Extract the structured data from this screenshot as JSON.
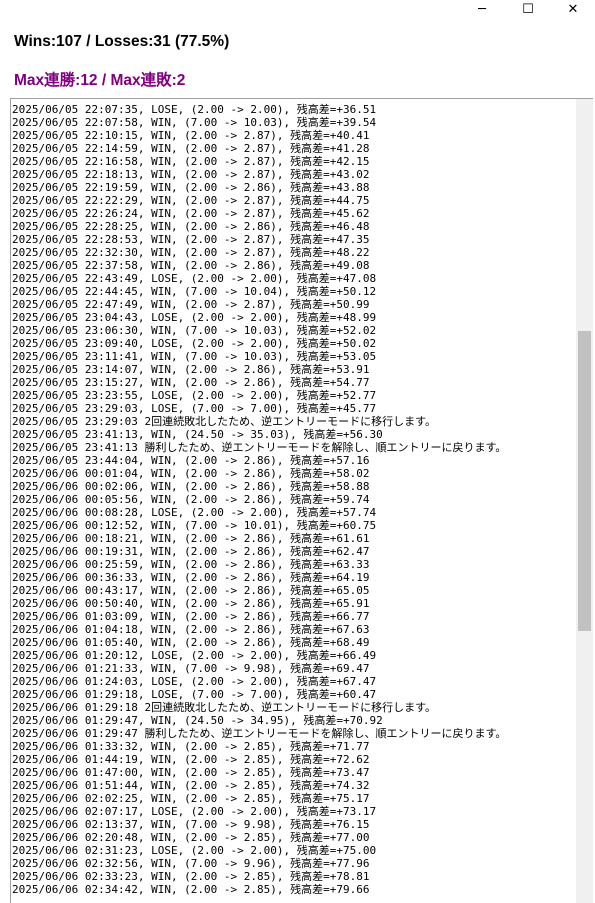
{
  "window": {
    "minimize_glyph": "─",
    "maximize_glyph": "☐",
    "close_glyph": "✕"
  },
  "stats": {
    "text": "Wins:107 / Losses:31 (77.5%)"
  },
  "streak": {
    "text": "Max連勝:12 / Max連敗:2",
    "color": "#800080"
  },
  "scroll": {
    "position_fraction": 0.46
  },
  "log": [
    "2025/06/05 22:07:35, LOSE, (2.00 -> 2.00), 残高差=+36.51",
    "2025/06/05 22:07:58, WIN, (7.00 -> 10.03), 残高差=+39.54",
    "2025/06/05 22:10:15, WIN, (2.00 -> 2.87), 残高差=+40.41",
    "2025/06/05 22:14:59, WIN, (2.00 -> 2.87), 残高差=+41.28",
    "2025/06/05 22:16:58, WIN, (2.00 -> 2.87), 残高差=+42.15",
    "2025/06/05 22:18:13, WIN, (2.00 -> 2.87), 残高差=+43.02",
    "2025/06/05 22:19:59, WIN, (2.00 -> 2.86), 残高差=+43.88",
    "2025/06/05 22:22:29, WIN, (2.00 -> 2.87), 残高差=+44.75",
    "2025/06/05 22:26:24, WIN, (2.00 -> 2.87), 残高差=+45.62",
    "2025/06/05 22:28:25, WIN, (2.00 -> 2.86), 残高差=+46.48",
    "2025/06/05 22:28:53, WIN, (2.00 -> 2.87), 残高差=+47.35",
    "2025/06/05 22:32:30, WIN, (2.00 -> 2.87), 残高差=+48.22",
    "2025/06/05 22:37:58, WIN, (2.00 -> 2.86), 残高差=+49.08",
    "2025/06/05 22:43:49, LOSE, (2.00 -> 2.00), 残高差=+47.08",
    "2025/06/05 22:44:45, WIN, (7.00 -> 10.04), 残高差=+50.12",
    "2025/06/05 22:47:49, WIN, (2.00 -> 2.87), 残高差=+50.99",
    "2025/06/05 23:04:43, LOSE, (2.00 -> 2.00), 残高差=+48.99",
    "2025/06/05 23:06:30, WIN, (7.00 -> 10.03), 残高差=+52.02",
    "2025/06/05 23:09:40, LOSE, (2.00 -> 2.00), 残高差=+50.02",
    "2025/06/05 23:11:41, WIN, (7.00 -> 10.03), 残高差=+53.05",
    "2025/06/05 23:14:07, WIN, (2.00 -> 2.86), 残高差=+53.91",
    "2025/06/05 23:15:27, WIN, (2.00 -> 2.86), 残高差=+54.77",
    "2025/06/05 23:23:55, LOSE, (2.00 -> 2.00), 残高差=+52.77",
    "2025/06/05 23:29:03, LOSE, (7.00 -> 7.00), 残高差=+45.77",
    "2025/06/05 23:29:03 2回連続敗北したため、逆エントリーモードに移行します。",
    "2025/06/05 23:41:13, WIN, (24.50 -> 35.03), 残高差=+56.30",
    "2025/06/05 23:41:13 勝利したため、逆エントリーモードを解除し、順エントリーに戻ります。",
    "2025/06/05 23:44:04, WIN, (2.00 -> 2.86), 残高差=+57.16",
    "2025/06/06 00:01:04, WIN, (2.00 -> 2.86), 残高差=+58.02",
    "2025/06/06 00:02:06, WIN, (2.00 -> 2.86), 残高差=+58.88",
    "2025/06/06 00:05:56, WIN, (2.00 -> 2.86), 残高差=+59.74",
    "2025/06/06 00:08:28, LOSE, (2.00 -> 2.00), 残高差=+57.74",
    "2025/06/06 00:12:52, WIN, (7.00 -> 10.01), 残高差=+60.75",
    "2025/06/06 00:18:21, WIN, (2.00 -> 2.86), 残高差=+61.61",
    "2025/06/06 00:19:31, WIN, (2.00 -> 2.86), 残高差=+62.47",
    "2025/06/06 00:25:59, WIN, (2.00 -> 2.86), 残高差=+63.33",
    "2025/06/06 00:36:33, WIN, (2.00 -> 2.86), 残高差=+64.19",
    "2025/06/06 00:43:17, WIN, (2.00 -> 2.86), 残高差=+65.05",
    "2025/06/06 00:50:40, WIN, (2.00 -> 2.86), 残高差=+65.91",
    "2025/06/06 01:03:09, WIN, (2.00 -> 2.86), 残高差=+66.77",
    "2025/06/06 01:04:18, WIN, (2.00 -> 2.86), 残高差=+67.63",
    "2025/06/06 01:05:40, WIN, (2.00 -> 2.86), 残高差=+68.49",
    "2025/06/06 01:20:12, LOSE, (2.00 -> 2.00), 残高差=+66.49",
    "2025/06/06 01:21:33, WIN, (7.00 -> 9.98), 残高差=+69.47",
    "2025/06/06 01:24:03, LOSE, (2.00 -> 2.00), 残高差=+67.47",
    "2025/06/06 01:29:18, LOSE, (7.00 -> 7.00), 残高差=+60.47",
    "2025/06/06 01:29:18 2回連続敗北したため、逆エントリーモードに移行します。",
    "2025/06/06 01:29:47, WIN, (24.50 -> 34.95), 残高差=+70.92",
    "2025/06/06 01:29:47 勝利したため、逆エントリーモードを解除し、順エントリーに戻ります。",
    "2025/06/06 01:33:32, WIN, (2.00 -> 2.85), 残高差=+71.77",
    "2025/06/06 01:44:19, WIN, (2.00 -> 2.85), 残高差=+72.62",
    "2025/06/06 01:47:00, WIN, (2.00 -> 2.85), 残高差=+73.47",
    "2025/06/06 01:51:44, WIN, (2.00 -> 2.85), 残高差=+74.32",
    "2025/06/06 02:02:25, WIN, (2.00 -> 2.85), 残高差=+75.17",
    "2025/06/06 02:07:17, LOSE, (2.00 -> 2.00), 残高差=+73.17",
    "2025/06/06 02:13:37, WIN, (7.00 -> 9.98), 残高差=+76.15",
    "2025/06/06 02:20:48, WIN, (2.00 -> 2.85), 残高差=+77.00",
    "2025/06/06 02:31:23, LOSE, (2.00 -> 2.00), 残高差=+75.00",
    "2025/06/06 02:32:56, WIN, (7.00 -> 9.96), 残高差=+77.96",
    "2025/06/06 02:33:23, WIN, (2.00 -> 2.85), 残高差=+78.81",
    "2025/06/06 02:34:42, WIN, (2.00 -> 2.85), 残高差=+79.66"
  ]
}
